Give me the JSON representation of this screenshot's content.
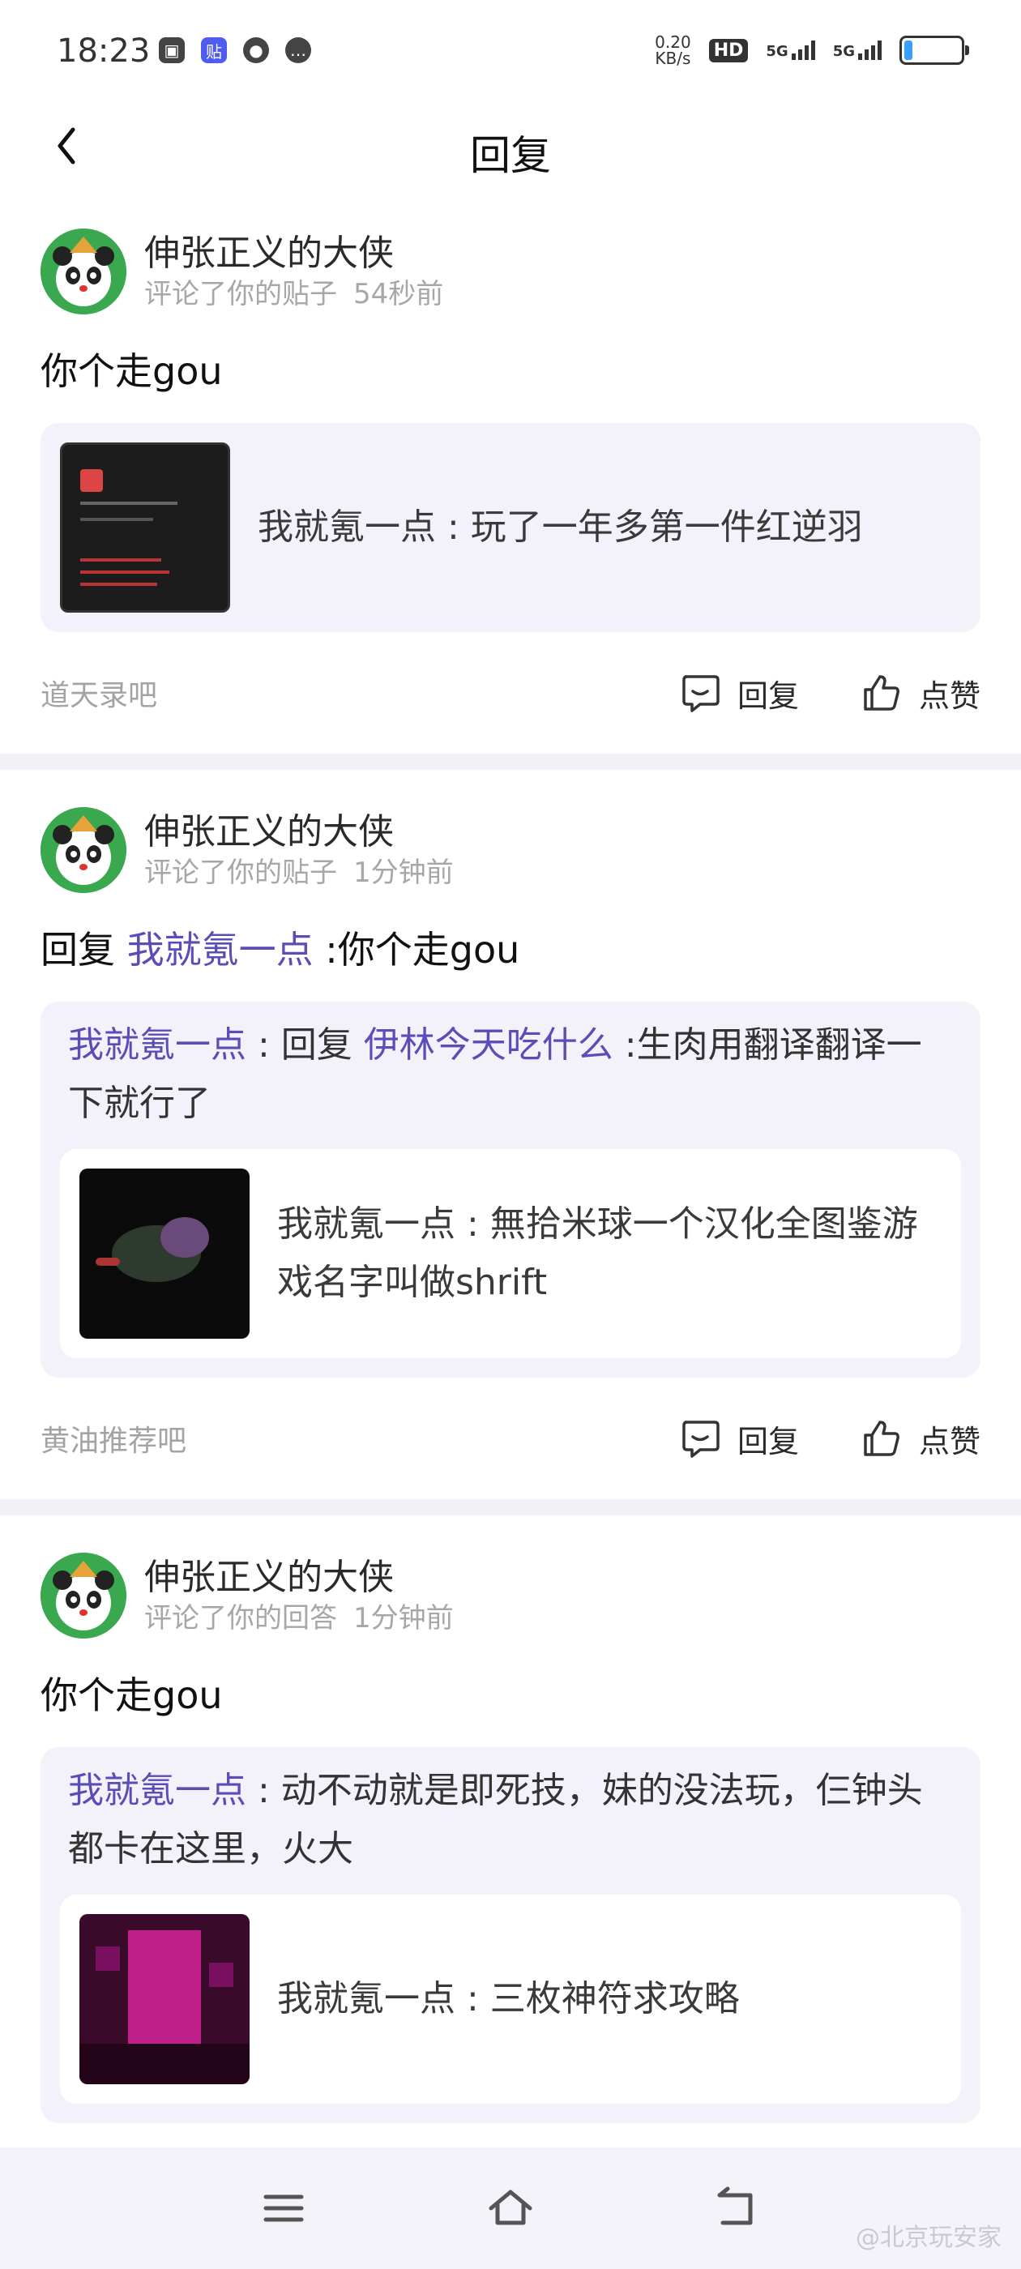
{
  "status_bar": {
    "time": "18:23",
    "icons": [
      "tv-icon",
      "tieba-icon",
      "wechat-icon",
      "message-icon"
    ],
    "net_speed_value": "0.20",
    "net_speed_unit": "KB/s",
    "hd_label": "HD",
    "net1": "5G",
    "net2": "5G"
  },
  "header": {
    "title": "回复"
  },
  "items": [
    {
      "username": "伸张正义的大侠",
      "action": "评论了你的贴子",
      "time": "54秒前",
      "content": "你个走gou",
      "post_author": "我就氪一点",
      "post_sep": " : ",
      "post_title": "玩了一年多第一件红逆羽",
      "forum": "道天录吧",
      "reply_label": "回复",
      "like_label": "点赞"
    },
    {
      "username": "伸张正义的大侠",
      "action": "评论了你的贴子",
      "time": "1分钟前",
      "content_prefix": "回复 ",
      "content_mention": "我就氪一点",
      "content_suffix": " :你个走gou",
      "quote_author": "我就氪一点",
      "quote_sep": " : 回复 ",
      "quote_mention": "伊林今天吃什么",
      "quote_text": " :生肉用翻译翻译一下就行了",
      "post_author": "我就氪一点",
      "post_sep": " : ",
      "post_title": "無拾米球一个汉化全图鉴游戏名字叫做shrift",
      "forum": "黄油推荐吧",
      "reply_label": "回复",
      "like_label": "点赞"
    },
    {
      "username": "伸张正义的大侠",
      "action": "评论了你的回答",
      "time": "1分钟前",
      "content": "你个走gou",
      "quote_author": "我就氪一点",
      "quote_sep": " : ",
      "quote_text": "动不动就是即死技，妹的没法玩，仨钟头都卡在这里，火大",
      "post_author": "我就氪一点",
      "post_sep": " : ",
      "post_title": "三枚神符求攻略"
    }
  ],
  "watermark": "@北京玩安家",
  "colors": {
    "accent": "#5b4db7",
    "quote_bg": "#f3f2fa",
    "meta_text": "#a7a7a7"
  }
}
